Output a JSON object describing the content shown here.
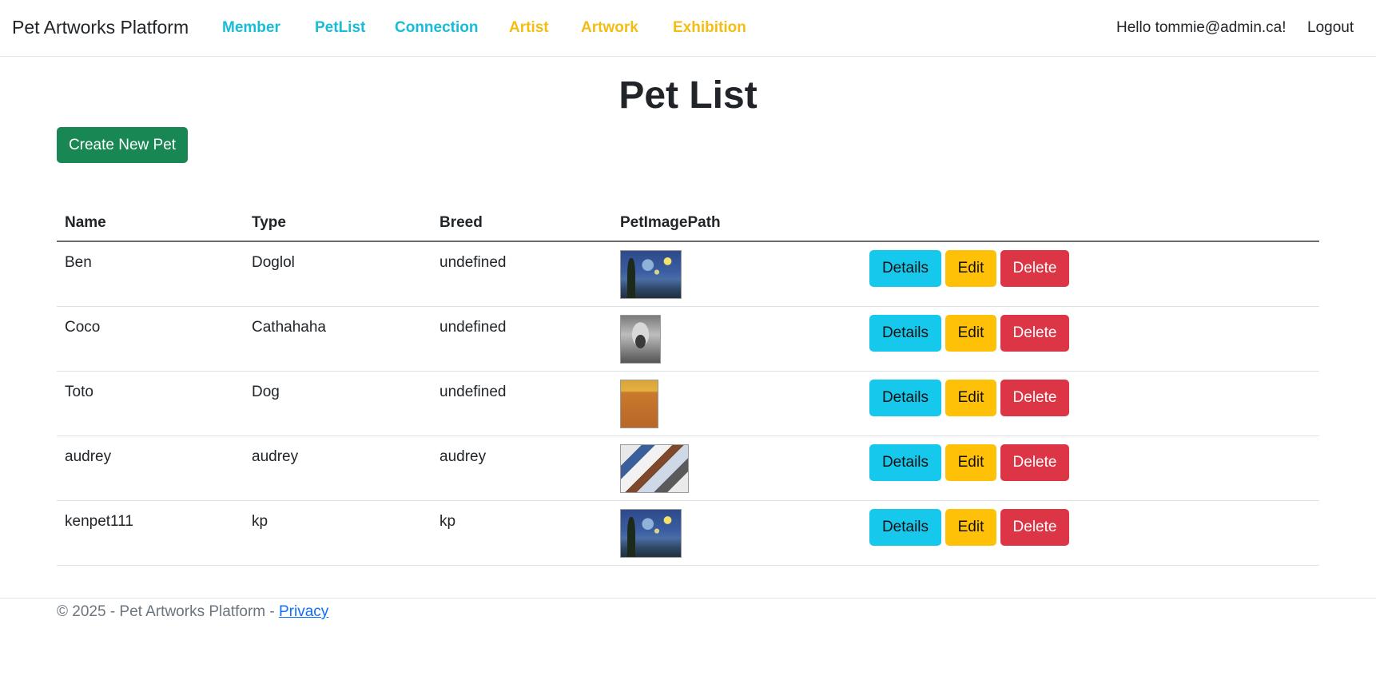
{
  "navbar": {
    "brand": "Pet Artworks Platform",
    "links": [
      {
        "label": "Member",
        "color": "#17bcd7"
      },
      {
        "label": "PetList",
        "color": "#17bcd7"
      },
      {
        "label": "Connection",
        "color": "#17bcd7"
      },
      {
        "label": "Artist",
        "color": "#f3bd14"
      },
      {
        "label": "Artwork",
        "color": "#f3bd14"
      },
      {
        "label": "Exhibition",
        "color": "#f3bd14"
      }
    ],
    "greeting": "Hello tommie@admin.ca!",
    "logout": "Logout"
  },
  "main": {
    "title": "Pet List",
    "create_button": "Create New Pet",
    "table": {
      "headers": [
        "Name",
        "Type",
        "Breed",
        "PetImagePath"
      ],
      "rows": [
        {
          "name": "Ben",
          "type": "Doglol",
          "breed": "undefined",
          "image": "starry-night-thumbnail"
        },
        {
          "name": "Coco",
          "type": "Cathahaha",
          "breed": "undefined",
          "image": "the-scream-grayscale-thumbnail"
        },
        {
          "name": "Toto",
          "type": "Dog",
          "breed": "undefined",
          "image": "rothko-color-field-thumbnail"
        },
        {
          "name": "audrey",
          "type": "audrey",
          "breed": "audrey",
          "image": "collage-thumbnail"
        },
        {
          "name": "kenpet111",
          "type": "kp",
          "breed": "kp",
          "image": "starry-night-thumbnail"
        }
      ],
      "actions": {
        "details": "Details",
        "edit": "Edit",
        "delete": "Delete"
      }
    }
  },
  "footer": {
    "text": "© 2025 - Pet Artworks Platform - ",
    "privacy": "Privacy"
  },
  "colors": {
    "success": "#198754",
    "info": "#17c8ed",
    "warning": "#ffc107",
    "danger": "#dc3545",
    "link": "#0d6efd"
  }
}
